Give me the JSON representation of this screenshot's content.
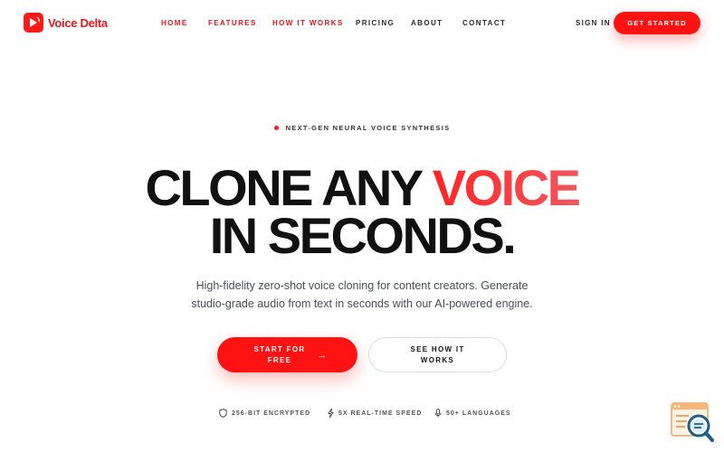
{
  "brand": {
    "name": "Voice Delta",
    "color": "#e8161b"
  },
  "nav": {
    "links": [
      {
        "label": "HOME",
        "active": true
      },
      {
        "label": "FEATURES",
        "active": true
      },
      {
        "label": "HOW IT WORKS",
        "active": true
      },
      {
        "label": "PRICING",
        "active": false
      },
      {
        "label": "ABOUT",
        "active": false
      },
      {
        "label": "CONTACT",
        "active": false
      }
    ],
    "sign_in": "SIGN IN",
    "cta": "GET STARTED"
  },
  "hero": {
    "eyebrow": "NEXT-GEN NEURAL VOICE SYNTHESIS",
    "headline_line1_a": "CLONE ANY ",
    "headline_line1_accent": "VOICE",
    "headline_line2": "IN SECONDS.",
    "subtitle": "High-fidelity zero-shot voice cloning for content creators. Generate studio-grade audio from text in seconds with our AI-powered engine.",
    "primary_button": "START FOR FREE",
    "secondary_button": "SEE HOW IT WORKS"
  },
  "features": [
    {
      "label": "256-BIT ENCRYPTED",
      "icon": "shield-icon"
    },
    {
      "label": "5X REAL-TIME SPEED",
      "icon": "lightning-icon"
    },
    {
      "label": "50+ LANGUAGES",
      "icon": "microphone-icon"
    }
  ],
  "colors": {
    "accent": "#ff1212",
    "text": "#111111",
    "muted": "#4a4f57"
  }
}
